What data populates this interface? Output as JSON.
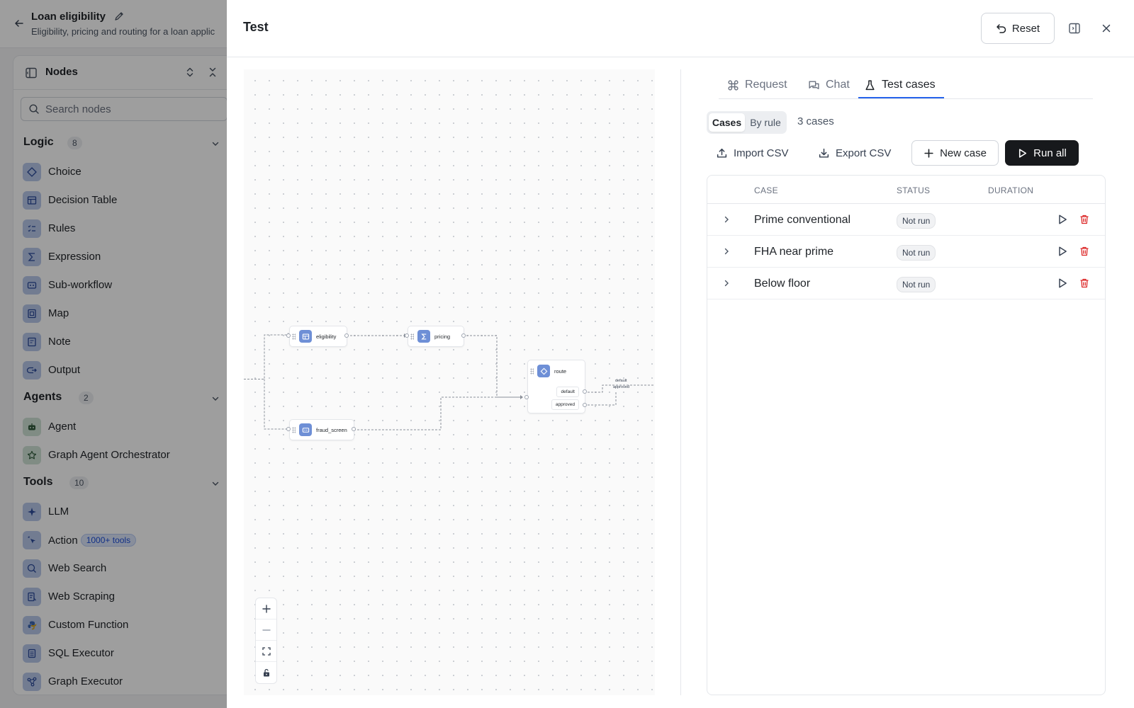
{
  "app": {
    "title": "Loan eligibility",
    "subtitle": "Eligibility, pricing and routing for a loan applic"
  },
  "nodes_panel": {
    "title": "Nodes",
    "search_placeholder": "Search nodes",
    "groups": [
      {
        "title": "Logic",
        "count": "8",
        "items": [
          "Choice",
          "Decision Table",
          "Rules",
          "Expression",
          "Sub-workflow",
          "Map",
          "Note",
          "Output"
        ]
      },
      {
        "title": "Agents",
        "count": "2",
        "items": [
          "Agent",
          "Graph Agent Orchestrator"
        ]
      },
      {
        "title": "Tools",
        "count": "10",
        "items": [
          "LLM",
          "Action",
          "Web Search",
          "Web Scraping",
          "Custom Function",
          "SQL Executor",
          "Graph Executor"
        ]
      }
    ],
    "action_badge": "1000+ tools"
  },
  "drawer": {
    "title": "Test",
    "reset_label": "Reset"
  },
  "canvas": {
    "nodes": {
      "eligibility": "eligibility",
      "pricing": "pricing",
      "fraud_screen": "fraud_screen",
      "route": "route"
    },
    "route_ports": {
      "default": "default",
      "approved": "approved"
    },
    "edge_labels": {
      "default": "default",
      "approved": "approved"
    }
  },
  "tabs": {
    "request": "Request",
    "chat": "Chat",
    "test_cases": "Test cases",
    "active": "test_cases"
  },
  "segment": {
    "cases": "Cases",
    "by_rule": "By rule",
    "active": "cases"
  },
  "case_count": "3 cases",
  "actions": {
    "import": "Import CSV",
    "export": "Export CSV",
    "new_case": "New case",
    "run_all": "Run all"
  },
  "table": {
    "headers": {
      "case": "CASE",
      "status": "STATUS",
      "duration": "DURATION"
    },
    "rows": [
      {
        "name": "Prime conventional",
        "status": "Not run"
      },
      {
        "name": "FHA near prime",
        "status": "Not run"
      },
      {
        "name": "Below floor",
        "status": "Not run"
      }
    ]
  },
  "colors": {
    "accent": "#2563eb",
    "run_button": "#17191c",
    "delete": "#dc2626",
    "node_icon": "#6e8fd6"
  }
}
